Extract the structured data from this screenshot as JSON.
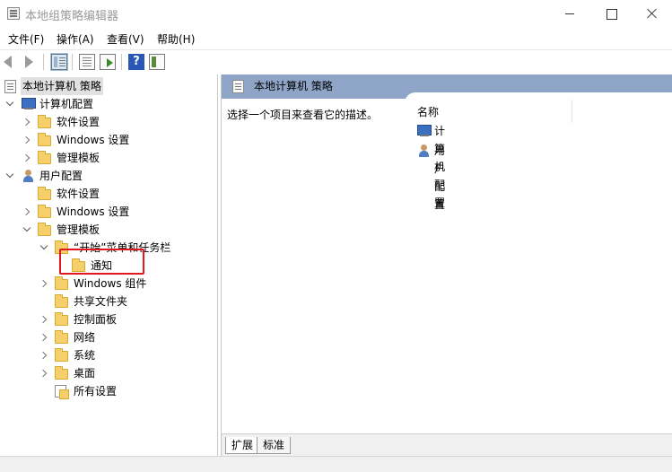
{
  "window": {
    "title": "本地组策略编辑器",
    "controls": {
      "minimize": "",
      "maximize": "",
      "close": ""
    }
  },
  "menu": [
    "文件(F)",
    "操作(A)",
    "查看(V)",
    "帮助(H)"
  ],
  "toolbar": {
    "back": "back-arrow-icon",
    "forward": "forward-arrow-icon",
    "show_hide_tree": "tree-pane-icon",
    "properties": "properties-icon",
    "export": "export-list-icon",
    "help": "?",
    "view": "view-icon"
  },
  "tree": {
    "root": "本地计算机 策略",
    "computer_config": {
      "label": "计算机配置",
      "children": [
        "软件设置",
        "Windows 设置",
        "管理模板"
      ]
    },
    "user_config": {
      "label": "用户配置",
      "children": [
        "软件设置",
        "Windows 设置",
        "管理模板"
      ],
      "admin_templates": {
        "start_menu": "“开始”菜单和任务栏",
        "notification": "通知",
        "items": [
          "Windows 组件",
          "共享文件夹",
          "控制面板",
          "网络",
          "系统",
          "桌面",
          "所有设置"
        ]
      }
    }
  },
  "detail": {
    "header": "本地计算机 策略",
    "description": "选择一个项目来查看它的描述。",
    "column_name": "名称",
    "items": [
      "计算机配置",
      "用户配置"
    ]
  },
  "tabs": [
    "扩展",
    "标准"
  ]
}
